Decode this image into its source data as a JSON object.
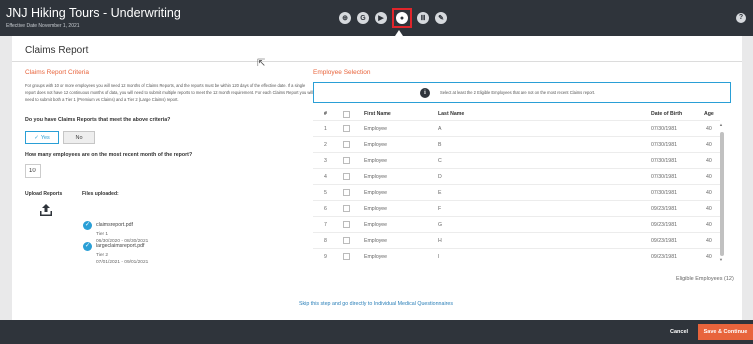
{
  "app": {
    "title": "JNJ Hiking Tours - Underwriting",
    "subtitle": "Effective Date November 1, 2021",
    "help_icon": "?"
  },
  "steps": [
    {
      "name": "globe-icon",
      "glyph": "⊕",
      "active": false
    },
    {
      "name": "circle-g-icon",
      "glyph": "G",
      "active": false
    },
    {
      "name": "play-icon",
      "glyph": "▶",
      "active": false
    },
    {
      "name": "claims-icon",
      "glyph": "●",
      "active": true
    },
    {
      "name": "columns-icon",
      "glyph": "Ⅲ",
      "active": false
    },
    {
      "name": "pencil-icon",
      "glyph": "✎",
      "active": false
    }
  ],
  "page": {
    "title": "Claims Report"
  },
  "criteria": {
    "heading": "Claims Report Criteria",
    "text": "For groups with 10 or more employees you will need 12 months of Claims Reports, and the reports must be within 120 days of the effective date. If a single report does not have 12 continuous months of data, you will need to submit multiple reports to meet the 12 month requirement. For each Claims Report you will need to submit both a Tier 1 (Premium vs Claims) and a Tier 2 (Large Claims) report.",
    "question1": "Do you have Claims Reports that meet the above criteria?",
    "yes_label": "Yes",
    "no_label": "No",
    "question2": "How many employees are on the most recent month of the report?",
    "employee_count": "10",
    "upload_label": "Upload Reports",
    "files_label": "Files uploaded:"
  },
  "files": [
    {
      "name": "claimsreport.pdf",
      "tier": "Tier 1",
      "dates": "06/30/2020 - 08/30/2021"
    },
    {
      "name": "largeclaimsreport.pdf",
      "tier": "Tier 2",
      "dates": "07/01/2021 - 09/01/2021"
    }
  ],
  "employee_selection": {
    "heading": "Employee Selection",
    "info": "Select at least the 2 Eligible Employees that are not on the most recent Claims report.",
    "columns": {
      "num": "#",
      "first": "First Name",
      "last": "Last Name",
      "dob": "Date of Birth",
      "age": "Age"
    },
    "rows": [
      {
        "num": "1",
        "first": "Employee",
        "last": "A",
        "dob": "07/30/1981",
        "age": "40"
      },
      {
        "num": "2",
        "first": "Employee",
        "last": "B",
        "dob": "07/30/1981",
        "age": "40"
      },
      {
        "num": "3",
        "first": "Employee",
        "last": "C",
        "dob": "07/30/1981",
        "age": "40"
      },
      {
        "num": "4",
        "first": "Employee",
        "last": "D",
        "dob": "07/30/1981",
        "age": "40"
      },
      {
        "num": "5",
        "first": "Employee",
        "last": "E",
        "dob": "07/30/1981",
        "age": "40"
      },
      {
        "num": "6",
        "first": "Employee",
        "last": "F",
        "dob": "09/23/1981",
        "age": "40"
      },
      {
        "num": "7",
        "first": "Employee",
        "last": "G",
        "dob": "09/23/1981",
        "age": "40"
      },
      {
        "num": "8",
        "first": "Employee",
        "last": "H",
        "dob": "09/23/1981",
        "age": "40"
      },
      {
        "num": "9",
        "first": "Employee",
        "last": "I",
        "dob": "09/23/1981",
        "age": "40"
      }
    ],
    "eligible": "Eligible Employees (12)"
  },
  "skip_link": "Skip this step and go directly to Individual Medical Questionnaires",
  "footer": {
    "cancel": "Cancel",
    "save": "Save & Continue"
  },
  "colors": {
    "accent": "#e8643c",
    "link": "#2a9fd6",
    "bar": "#2f343b",
    "active_step": "#e0252b"
  }
}
